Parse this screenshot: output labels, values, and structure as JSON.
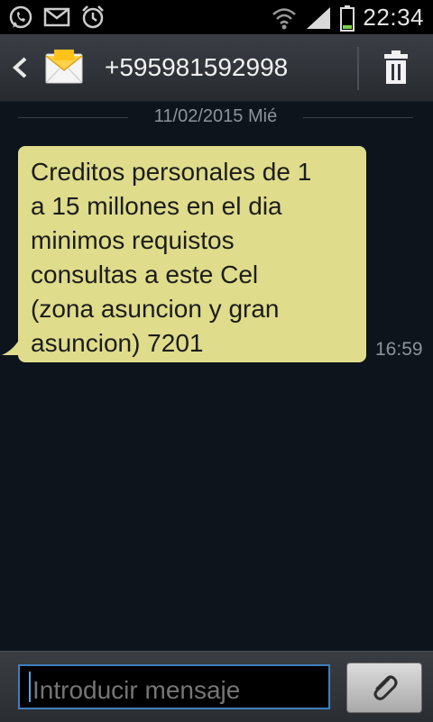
{
  "status_bar": {
    "icons": [
      "whatsapp-icon",
      "mail-icon",
      "alarm-icon",
      "wifi-icon",
      "signal-icon",
      "battery-icon"
    ],
    "time": "22:34"
  },
  "header": {
    "contact": "+595981592998",
    "icons": [
      "back-arrow-icon",
      "envelope-icon",
      "trash-icon"
    ]
  },
  "conversation": {
    "date": "11/02/2015 Mié",
    "messages": [
      {
        "text": "Creditos personales de 1\na 15 millones en el dia\nminimos requistos\nconsultas a este Cel\n(zona asuncion y gran\nasuncion) 7201",
        "time": "16:59",
        "bubble_color": "#dfdc8b"
      }
    ]
  },
  "composer": {
    "placeholder": "Introducir mensaje",
    "attach_icon": "paperclip-icon"
  },
  "colors": {
    "background": "#0d141b",
    "input_focus": "#3f7fbf"
  }
}
